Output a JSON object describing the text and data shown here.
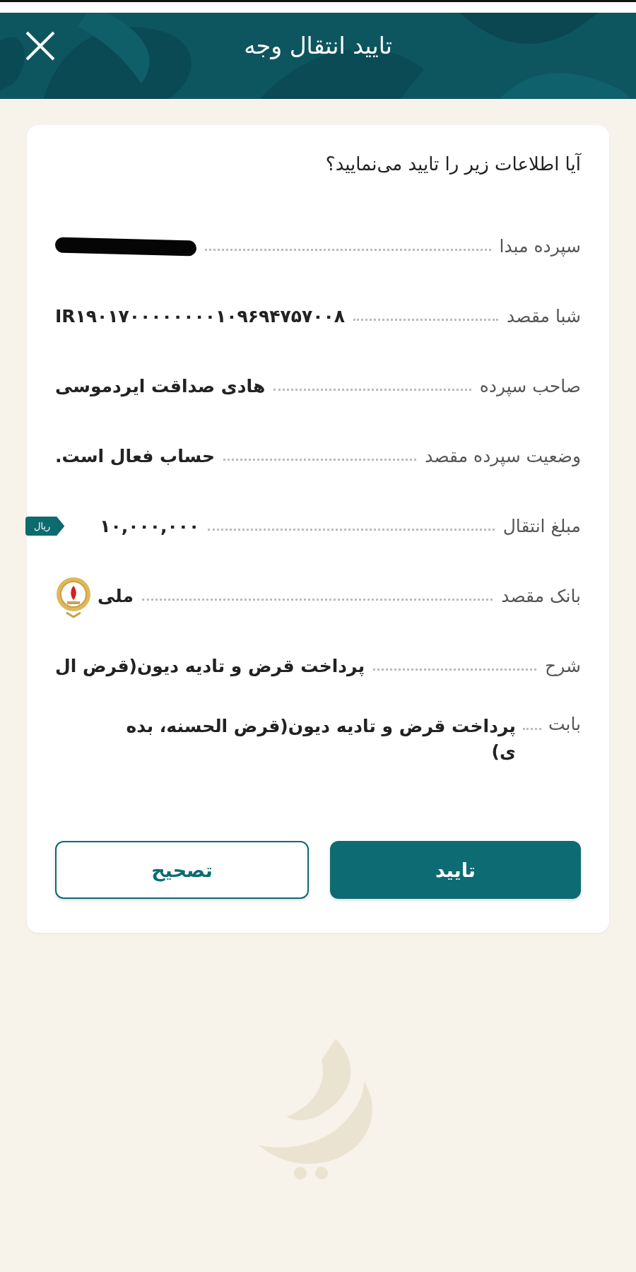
{
  "header": {
    "title": "تایید انتقال وجه"
  },
  "question": "آیا اطلاعات زیر را تایید می‌نمایید؟",
  "rows": [
    {
      "kind": "redacted",
      "label": "سپرده مبدا"
    },
    {
      "kind": "plain",
      "label": "شبا مقصد",
      "value": "IR۱۹۰۱۷۰۰۰۰۰۰۰۰۱۰۹۶۹۴۷۵۷۰۰۸"
    },
    {
      "kind": "plain",
      "label": "صاحب سپرده",
      "value": "هادی صداقت ایردموسی"
    },
    {
      "kind": "plain",
      "label": "وضعیت سپرده مقصد",
      "value": "حساب فعال است."
    },
    {
      "kind": "amount",
      "label": "مبلغ انتقال",
      "value": "۱۰,۰۰۰,۰۰۰",
      "unit": "ریال"
    },
    {
      "kind": "bank",
      "label": "بانک مقصد",
      "value": "ملی"
    },
    {
      "kind": "plain",
      "label": "شرح",
      "value": "پرداخت قرض و تادیه دیون(قرض ال"
    },
    {
      "kind": "multiline",
      "label": "بابت",
      "lines": [
        "پرداخت قرض و تادیه دیون(قرض الحسنه، بده",
        "ی)"
      ]
    }
  ],
  "buttons": [
    {
      "kind": "primary",
      "label": "تایید"
    },
    {
      "kind": "secondary",
      "label": "تصحیح"
    }
  ]
}
